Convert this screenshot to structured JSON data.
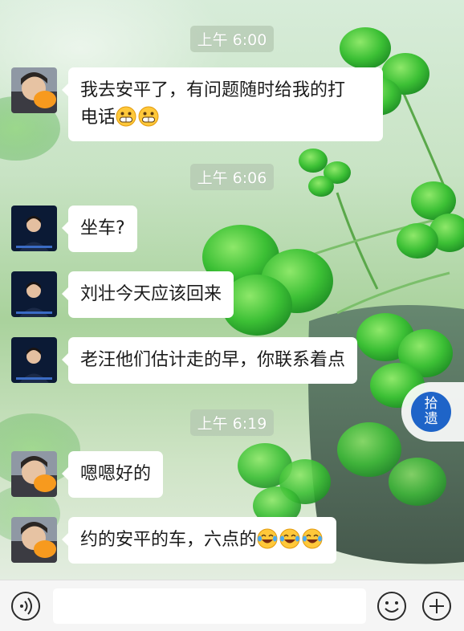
{
  "chat": {
    "timestamps": [
      "上午 6:00",
      "上午 6:06",
      "上午 6:19"
    ],
    "messages": [
      {
        "text_line1": "我去安平了，有问题随时给我的打",
        "text_line2": "电话",
        "emojis": [
          "grin-emoji",
          "grin-emoji"
        ]
      },
      {
        "text": "坐车?"
      },
      {
        "text": "刘壮今天应该回来"
      },
      {
        "text": "老汪他们估计走的早，你联系着点"
      },
      {
        "text": "嗯嗯好的"
      },
      {
        "text": "约的安平的车，六点的",
        "emojis": [
          "laugh-cry-emoji",
          "laugh-cry-emoji",
          "laugh-cry-emoji"
        ]
      }
    ]
  },
  "floating_badge": {
    "line1": "拾",
    "line2": "遗"
  },
  "input_bar": {
    "voice_icon": "voice-icon",
    "emoji_icon": "smiley-icon",
    "plus_icon": "plus-icon",
    "text_value": ""
  },
  "colors": {
    "bubble": "#ffffff",
    "badge_blue": "#1e64c8",
    "leaf_green": "#3fbf3a"
  }
}
